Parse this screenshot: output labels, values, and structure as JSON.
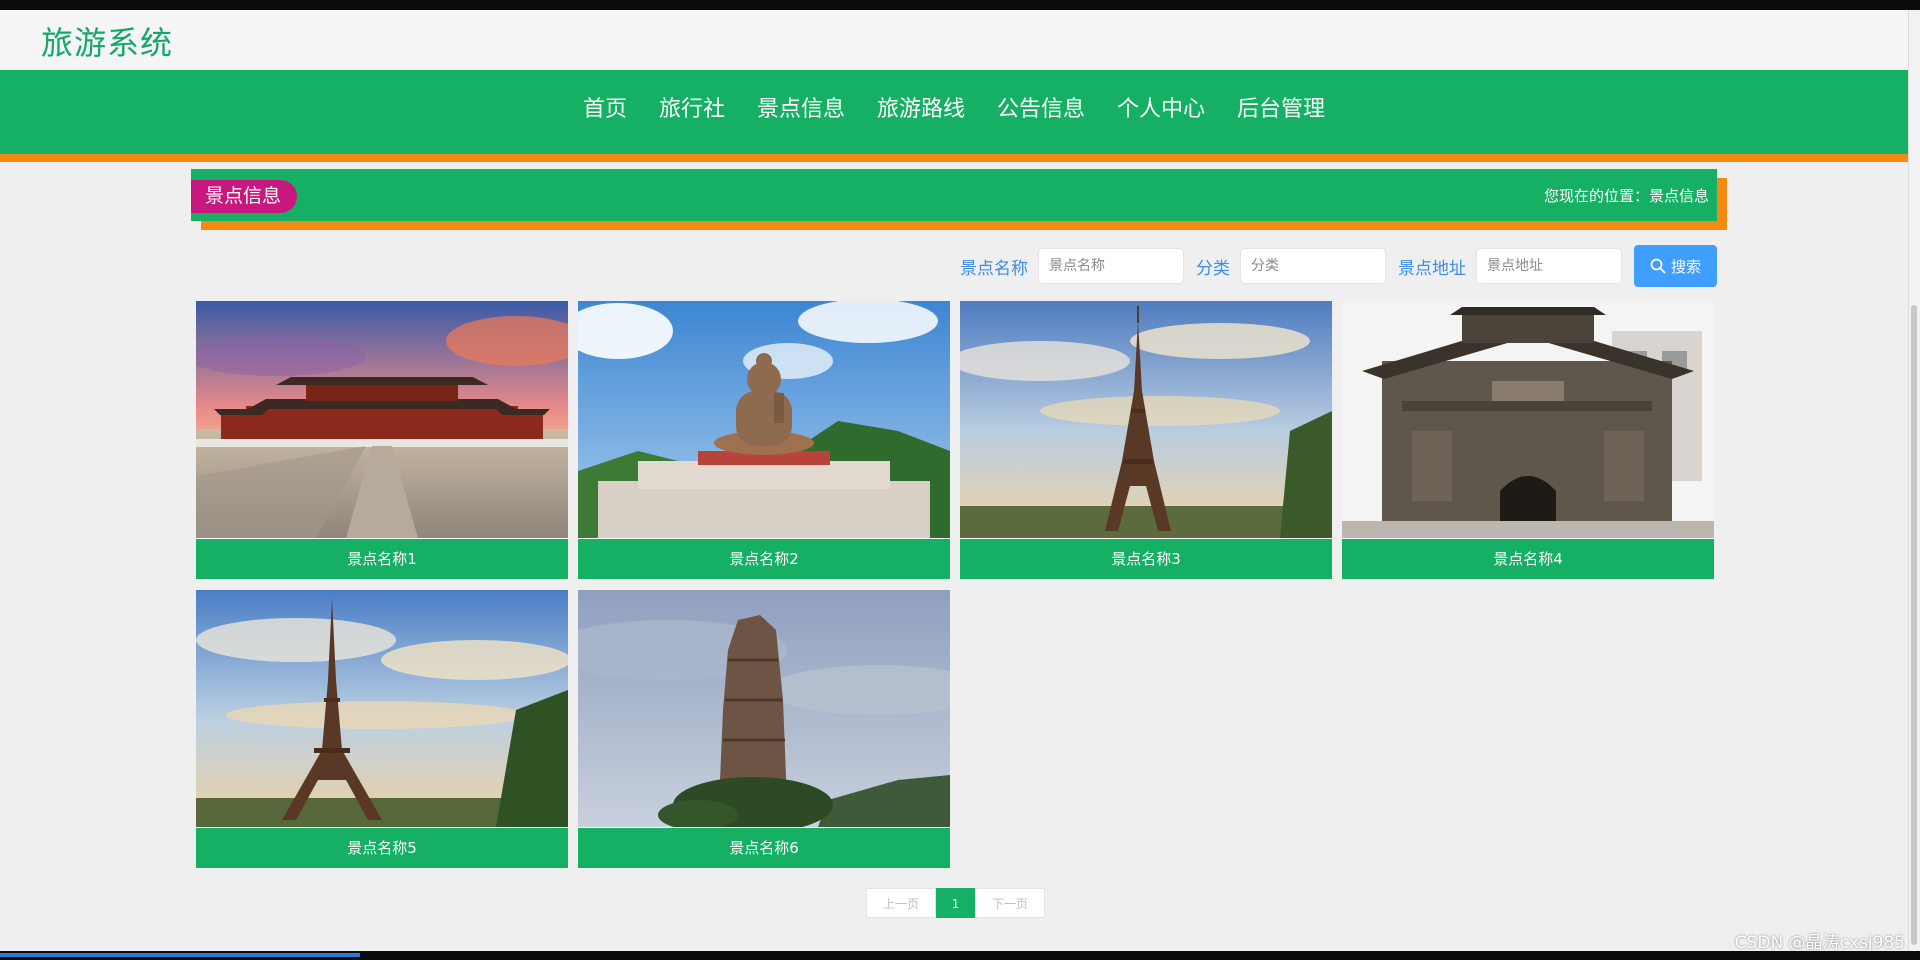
{
  "site": {
    "title": "旅游系统"
  },
  "nav": {
    "items": [
      "首页",
      "旅行社",
      "景点信息",
      "旅游路线",
      "公告信息",
      "个人中心",
      "后台管理"
    ]
  },
  "section": {
    "title": "景点信息",
    "breadcrumb": "您现在的位置：景点信息"
  },
  "search": {
    "name_label": "景点名称",
    "name_placeholder": "景点名称",
    "category_label": "分类",
    "category_placeholder": "分类",
    "address_label": "景点地址",
    "address_placeholder": "景点地址",
    "button_label": "搜索"
  },
  "cards": [
    {
      "name": "景点名称1",
      "image": "forbidden-city-photo"
    },
    {
      "name": "景点名称2",
      "image": "buddha-statue-photo"
    },
    {
      "name": "景点名称3",
      "image": "eiffel-tower-photo"
    },
    {
      "name": "景点名称4",
      "image": "ancient-gate-photo"
    },
    {
      "name": "景点名称5",
      "image": "eiffel-tower-photo"
    },
    {
      "name": "景点名称6",
      "image": "rock-pillar-photo"
    }
  ],
  "pagination": {
    "prev": "上一页",
    "current": "1",
    "next": "下一页"
  },
  "watermark": "CSDN @晶涛cxsj985",
  "colors": {
    "brand_green": "#16b065",
    "accent_orange": "#f58a12",
    "badge_magenta": "#c8177e",
    "search_blue": "#409eff"
  }
}
